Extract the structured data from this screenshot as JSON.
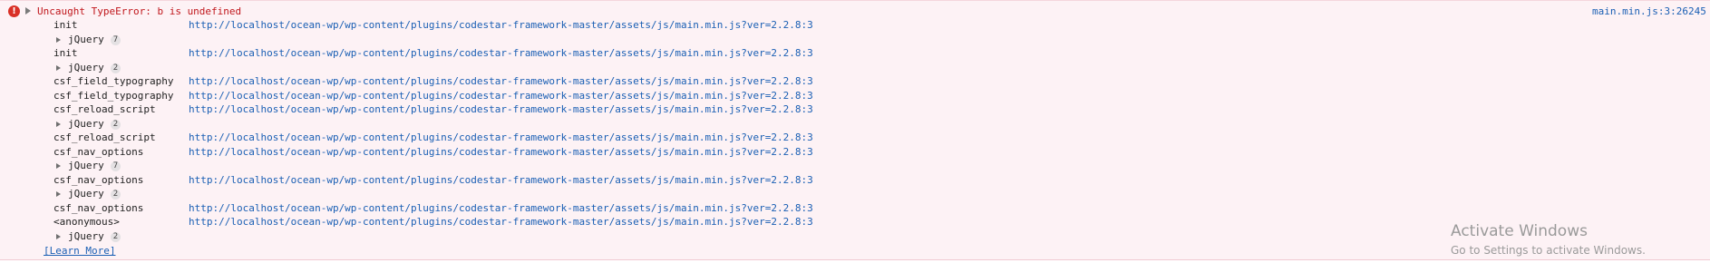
{
  "console": {
    "error": {
      "icon_glyph": "!",
      "message": "Uncaught TypeError: b is undefined",
      "source_link": "main.min.js:3:26245",
      "color": "#c0161b"
    },
    "stack": [
      {
        "kind": "frame",
        "function": "init",
        "url": "http://localhost/ocean-wp/wp-content/plugins/codestar-framework-master/assets/js/main.min.js?ver=2.2.8:3"
      },
      {
        "kind": "group",
        "label": "jQuery",
        "count": "7"
      },
      {
        "kind": "frame",
        "function": "init",
        "url": "http://localhost/ocean-wp/wp-content/plugins/codestar-framework-master/assets/js/main.min.js?ver=2.2.8:3"
      },
      {
        "kind": "group",
        "label": "jQuery",
        "count": "2"
      },
      {
        "kind": "frame",
        "function": "csf_field_typography",
        "url": "http://localhost/ocean-wp/wp-content/plugins/codestar-framework-master/assets/js/main.min.js?ver=2.2.8:3"
      },
      {
        "kind": "frame",
        "function": "csf_field_typography",
        "url": "http://localhost/ocean-wp/wp-content/plugins/codestar-framework-master/assets/js/main.min.js?ver=2.2.8:3"
      },
      {
        "kind": "frame",
        "function": "csf_reload_script",
        "url": "http://localhost/ocean-wp/wp-content/plugins/codestar-framework-master/assets/js/main.min.js?ver=2.2.8:3"
      },
      {
        "kind": "group",
        "label": "jQuery",
        "count": "2"
      },
      {
        "kind": "frame",
        "function": "csf_reload_script",
        "url": "http://localhost/ocean-wp/wp-content/plugins/codestar-framework-master/assets/js/main.min.js?ver=2.2.8:3"
      },
      {
        "kind": "frame",
        "function": "csf_nav_options",
        "url": "http://localhost/ocean-wp/wp-content/plugins/codestar-framework-master/assets/js/main.min.js?ver=2.2.8:3"
      },
      {
        "kind": "group",
        "label": "jQuery",
        "count": "7"
      },
      {
        "kind": "frame",
        "function": "csf_nav_options",
        "url": "http://localhost/ocean-wp/wp-content/plugins/codestar-framework-master/assets/js/main.min.js?ver=2.2.8:3"
      },
      {
        "kind": "group",
        "label": "jQuery",
        "count": "2"
      },
      {
        "kind": "frame",
        "function": "csf_nav_options",
        "url": "http://localhost/ocean-wp/wp-content/plugins/codestar-framework-master/assets/js/main.min.js?ver=2.2.8:3"
      },
      {
        "kind": "frame",
        "function": "<anonymous>",
        "url": "http://localhost/ocean-wp/wp-content/plugins/codestar-framework-master/assets/js/main.min.js?ver=2.2.8:3"
      },
      {
        "kind": "group",
        "label": "jQuery",
        "count": "2"
      }
    ],
    "learn_more": "[Learn More]"
  },
  "watermark": {
    "title": "Activate Windows",
    "subtitle": "Go to Settings to activate Windows."
  }
}
